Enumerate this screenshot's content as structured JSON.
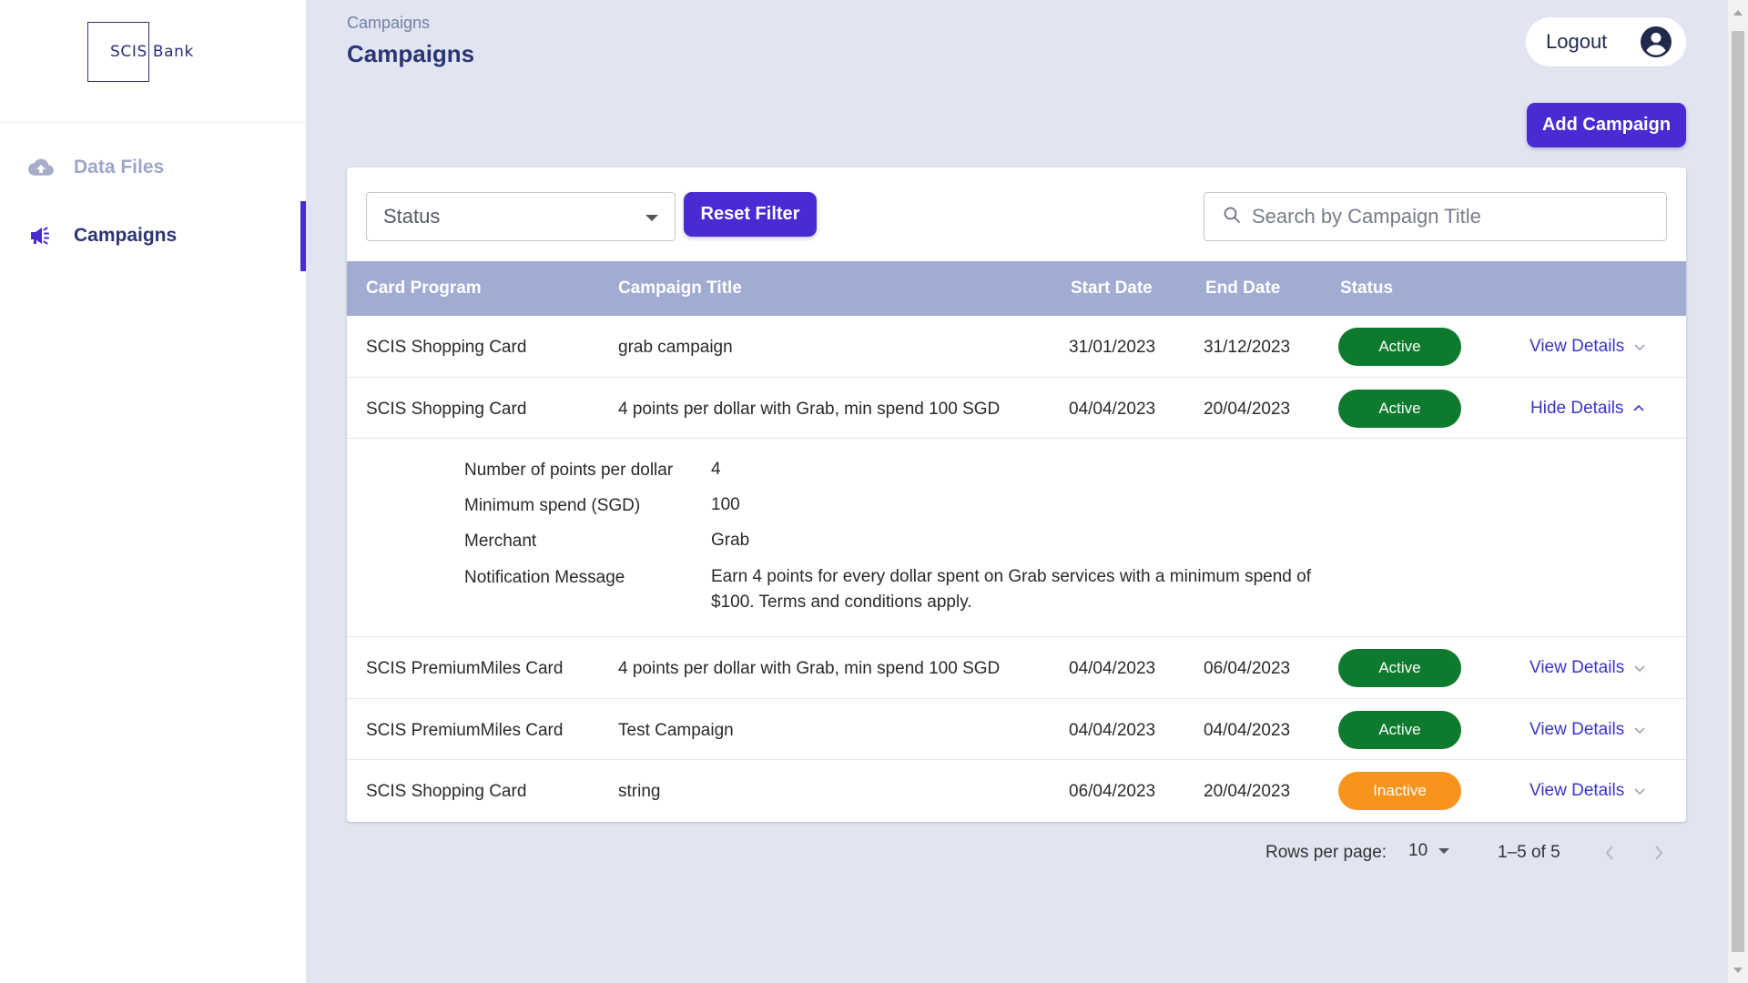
{
  "brand": {
    "logo_text": "SCIS Bank"
  },
  "sidebar": {
    "items": [
      {
        "label": "Data Files",
        "icon": "cloud-upload-icon"
      },
      {
        "label": "Campaigns",
        "icon": "megaphone-icon"
      }
    ],
    "active": "Campaigns"
  },
  "header": {
    "breadcrumb": "Campaigns",
    "title": "Campaigns",
    "logout_label": "Logout"
  },
  "actions": {
    "add_campaign_label": "Add Campaign"
  },
  "filters": {
    "status_label": "Status",
    "reset_label": "Reset Filter",
    "search_placeholder": "Search by Campaign Title"
  },
  "table": {
    "columns": [
      "Card Program",
      "Campaign Title",
      "Start Date",
      "End Date",
      "Status"
    ],
    "rows": [
      {
        "program": "SCIS Shopping Card",
        "title": "grab campaign",
        "start": "31/01/2023",
        "end": "31/12/2023",
        "status": "Active",
        "details": "View Details"
      },
      {
        "program": "SCIS Shopping Card",
        "title": "4 points per dollar with Grab, min spend 100 SGD",
        "start": "04/04/2023",
        "end": "20/04/2023",
        "status": "Active",
        "details": "Hide Details"
      },
      {
        "program": "SCIS PremiumMiles Card",
        "title": "4 points per dollar with Grab, min spend 100 SGD",
        "start": "04/04/2023",
        "end": "06/04/2023",
        "status": "Active",
        "details": "View Details"
      },
      {
        "program": "SCIS PremiumMiles Card",
        "title": "Test Campaign",
        "start": "04/04/2023",
        "end": "04/04/2023",
        "status": "Active",
        "details": "View Details"
      },
      {
        "program": "SCIS Shopping Card",
        "title": "string",
        "start": "06/04/2023",
        "end": "20/04/2023",
        "status": "Inactive",
        "details": "View Details"
      }
    ],
    "expanded_details": [
      {
        "label": "Number of points per dollar",
        "value": "4"
      },
      {
        "label": "Minimum spend (SGD)",
        "value": "100"
      },
      {
        "label": "Merchant",
        "value": "Grab"
      },
      {
        "label": "Notification Message",
        "value_line1": "Earn 4 points for every dollar spent on Grab services with a minimum spend of",
        "value_line2": "$100. Terms and conditions apply."
      }
    ]
  },
  "pagination": {
    "rows_per_page_label": "Rows per page:",
    "rows_per_page": "10",
    "range": "1–5 of 5"
  },
  "colors": {
    "primary": "#4a2bd3",
    "header_row": "#a1acd2",
    "active": "#0e7a2e",
    "inactive": "#f7941d",
    "background": "#e0e5f1"
  }
}
